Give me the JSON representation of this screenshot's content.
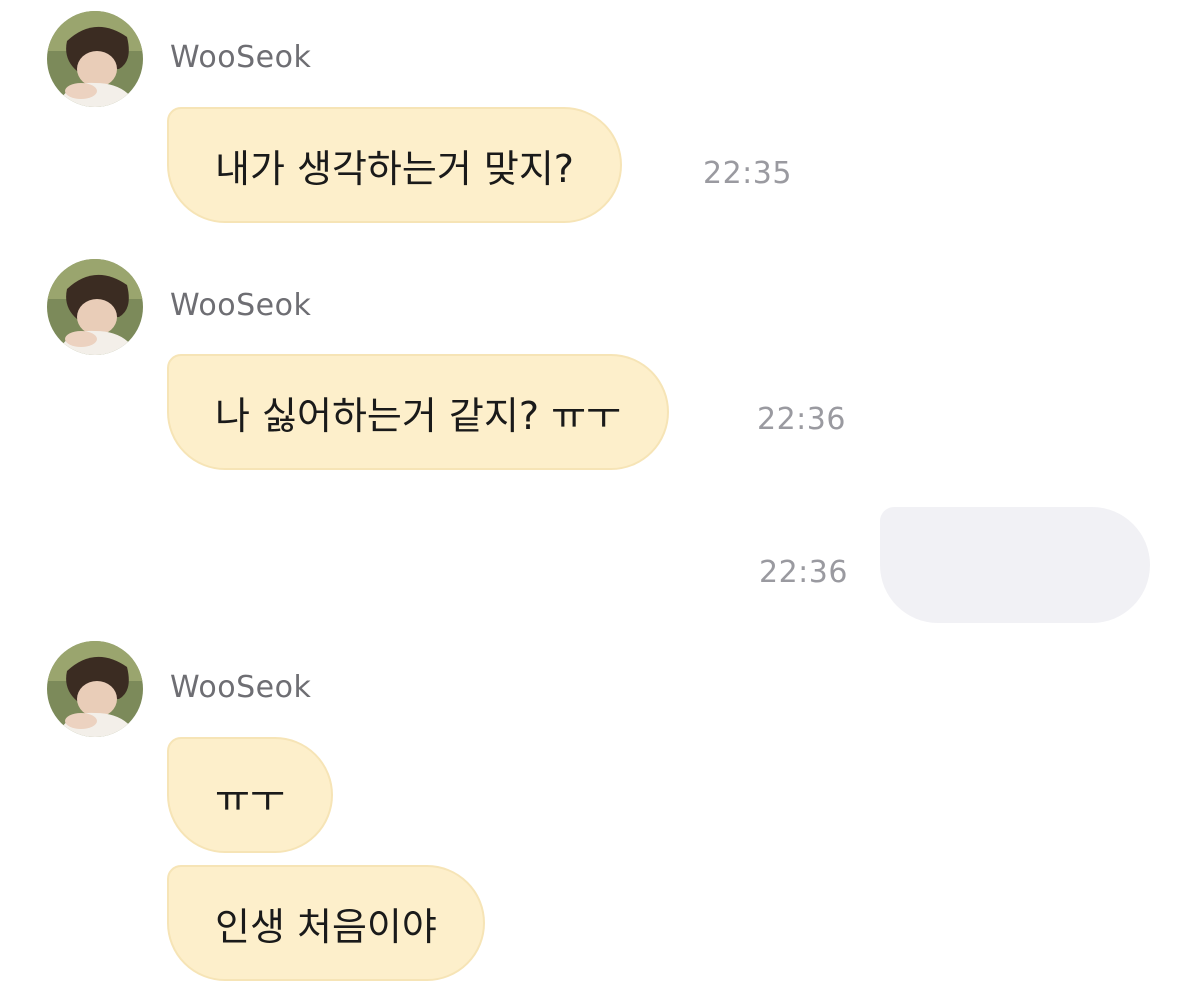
{
  "messages": [
    {
      "sender": "WooSeok",
      "text": "내가 생각하는거 맞지?",
      "time": "22:35"
    },
    {
      "sender": "WooSeok",
      "text": "나 싫어하는거 같지? ㅠㅜ",
      "time": "22:36"
    },
    {
      "sender": "",
      "text": "",
      "time": "22:36"
    },
    {
      "sender": "WooSeok",
      "text": "ㅠㅜ",
      "time": ""
    },
    {
      "sender": "WooSeok",
      "text": "인생 처음이야",
      "time": ""
    }
  ],
  "colors": {
    "incoming_bubble": "#fdefcb",
    "outgoing_bubble": "#f1f1f5",
    "timestamp": "#9a9aa0",
    "sender_name": "#6e6e73"
  }
}
